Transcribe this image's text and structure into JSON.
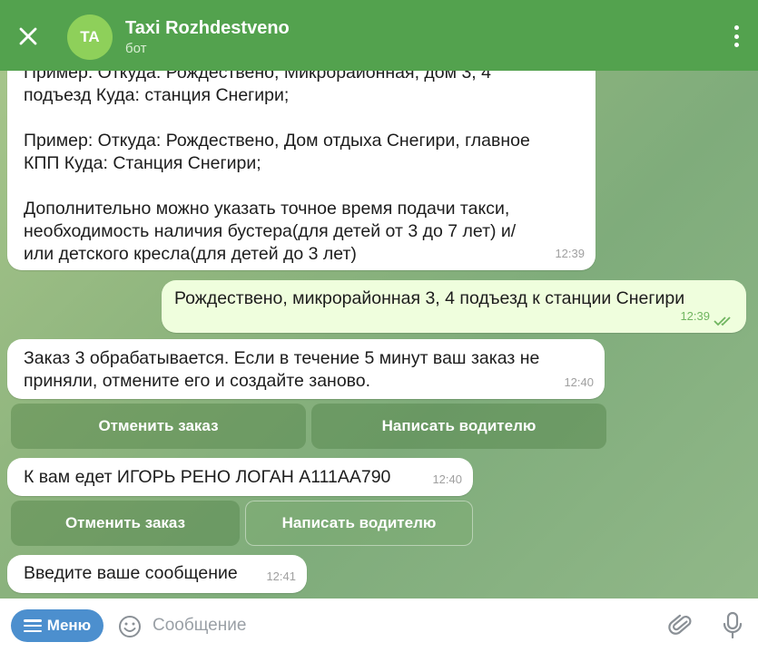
{
  "header": {
    "avatar_initials": "TA",
    "title": "Taxi Rozhdestveno",
    "subtitle": "бот"
  },
  "messages": [
    {
      "direction": "in",
      "lines": [
        "Пример: Откуда: Рождествено, Микрорайонная, дом 3, 4",
        "подъезд Куда: станция Снегири;",
        "",
        "Пример: Откуда: Рождествено, Дом отдыха Снегири, главное",
        "КПП Куда: Станция Снегири;",
        "",
        "Дополнительно можно указать точное время подачи такси,",
        "необходимость наличия бустера(для детей от 3 до 7 лет) и/",
        "или  детского кресла(для детей до 3 лет)"
      ],
      "time": "12:39"
    },
    {
      "direction": "out",
      "text": "Рождествено, микрорайонная 3, 4 подъезд к станции Снегири",
      "time": "12:39"
    },
    {
      "direction": "in",
      "lines": [
        "Заказ 3 обрабатывается. Если в течение 5 минут ваш заказ не",
        "приняли, отмените его и создайте заново."
      ],
      "time": "12:40"
    },
    {
      "direction": "in",
      "text": "К вам едет ИГОРЬ РЕНО ЛОГАН А111АА790",
      "time": "12:40"
    },
    {
      "direction": "in",
      "text": "Введите ваше сообщение",
      "time": "12:41"
    }
  ],
  "buttons": {
    "cancel_order_1": "Отменить заказ",
    "write_driver_1": "Написать водителю",
    "cancel_order_2": "Отменить заказ",
    "write_driver_2": "Написать водителю"
  },
  "inputbar": {
    "menu_label": "Меню",
    "placeholder": "Сообщение"
  },
  "icons": [
    "close-icon",
    "more-vert-icon",
    "emoji-icon",
    "attach-icon",
    "mic-icon",
    "double-check-icon",
    "menu-icon"
  ],
  "colors": {
    "header": "#53a24e",
    "outgoing_bubble": "#effedd",
    "menu_button": "#4c8fce",
    "avatar": "#8ed05a"
  }
}
